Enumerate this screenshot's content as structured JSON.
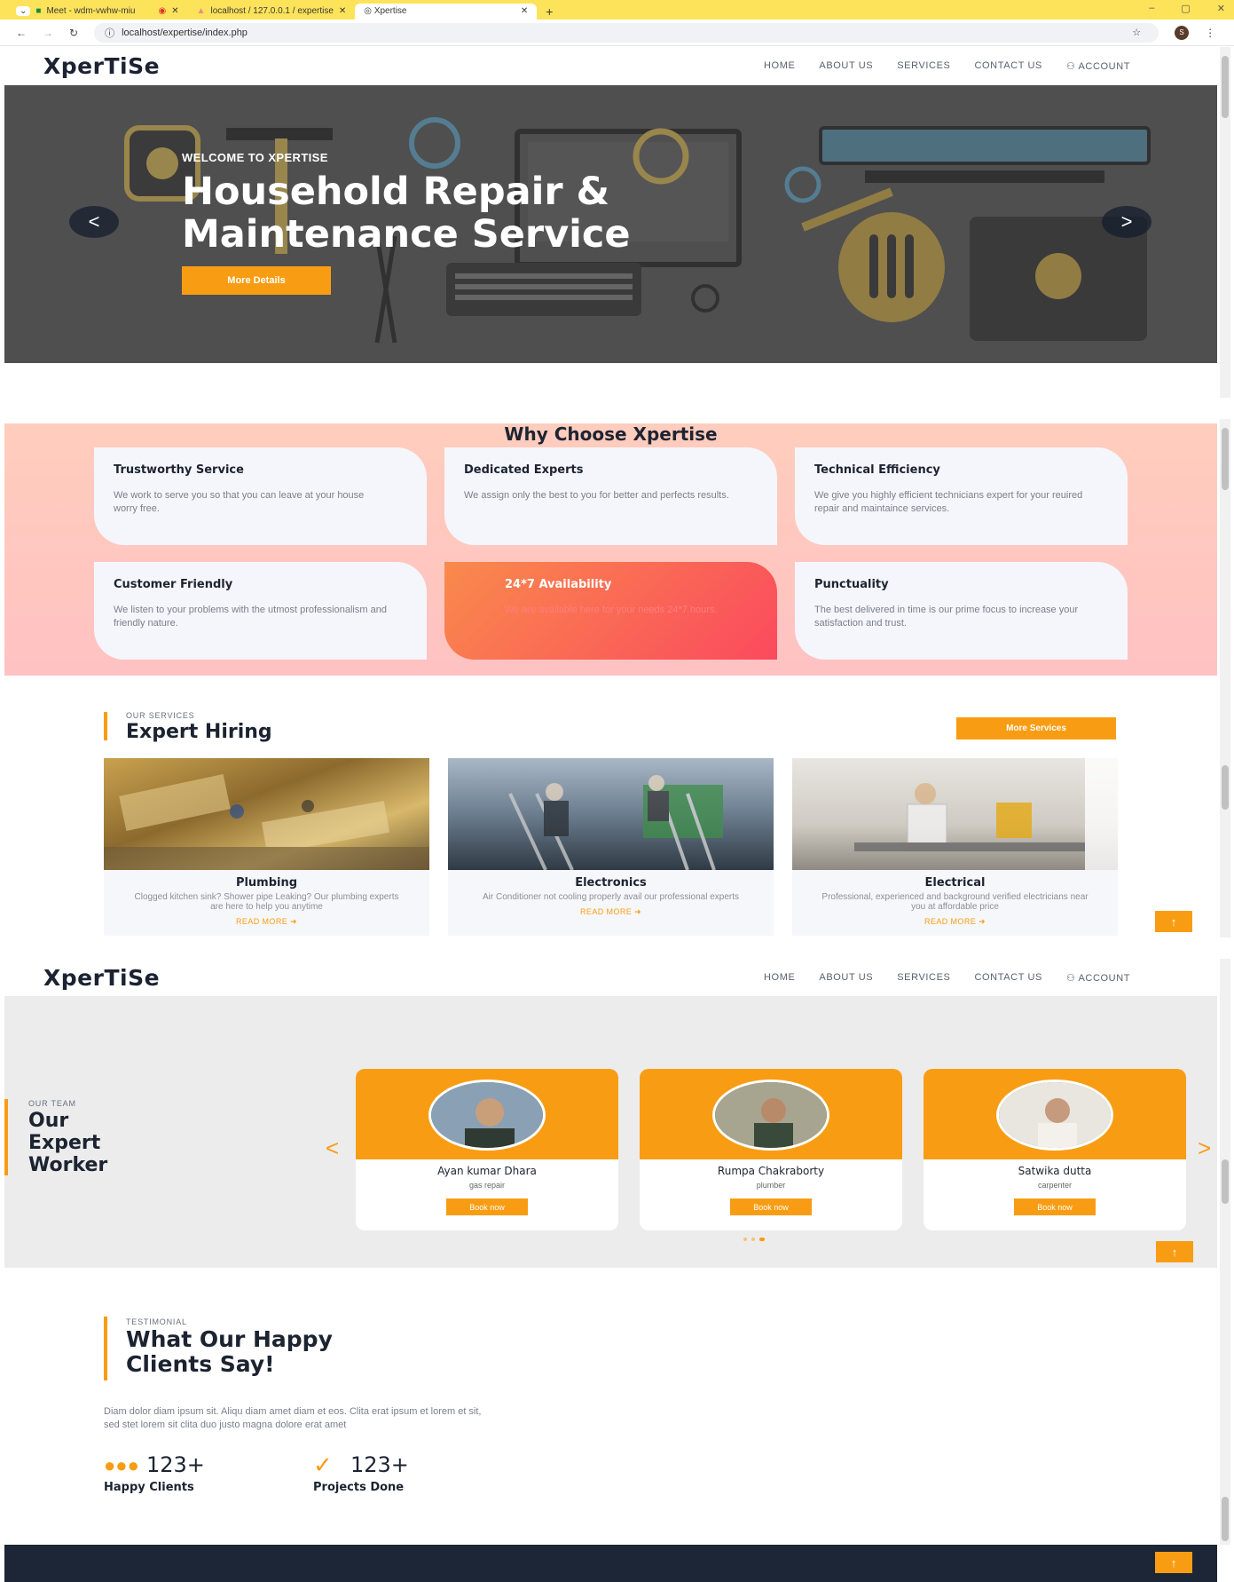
{
  "browser": {
    "tabs": [
      {
        "label": "Meet - wdm-vwhw-miu"
      },
      {
        "label": "localhost / 127.0.0.1 / expertise"
      },
      {
        "label": "Xpertise"
      }
    ],
    "new_tab": "+",
    "url": "localhost/expertise/index.php",
    "profile_initial": "S",
    "window_controls": [
      "–",
      "▢",
      "✕"
    ]
  },
  "nav": {
    "brand": "XperTiSe",
    "items": [
      "HOME",
      "ABOUT US",
      "SERVICES",
      "CONTACT US",
      "ACCOUNT"
    ]
  },
  "hero": {
    "eyebrow": "WELCOME TO XPERTISE",
    "title": "Household Repair & Maintenance Service",
    "cta": "More Details",
    "prev": "<",
    "next": ">"
  },
  "why": {
    "title": "Why Choose Xpertise",
    "cards": [
      {
        "title": "Trustworthy Service",
        "text": "We work to serve you so that you can leave at your house worry free."
      },
      {
        "title": "Dedicated Experts",
        "text": "We assign only the best to you for better and perfects results."
      },
      {
        "title": "Technical Efficiency",
        "text": "We give you highly efficient technicians expert for your reuired repair and maintaince services."
      },
      {
        "title": "Customer Friendly",
        "text": "We listen to your problems with the utmost professionalism and friendly nature."
      },
      {
        "title": "24*7 Availability",
        "text": "We are available here for your needs 24*7 hours."
      },
      {
        "title": "Punctuality",
        "text": "The best delivered in time is our prime focus to increase your satisfaction and trust."
      }
    ]
  },
  "services": {
    "eyebrow": "OUR SERVICES",
    "title": "Expert Hiring",
    "more_button": "More Services",
    "items": [
      {
        "title": "Plumbing",
        "text": "Clogged kitchen sink? Shower pipe Leaking? Our plumbing experts are here to help you anytime",
        "link": "READ MORE"
      },
      {
        "title": "Electronics",
        "text": "Air Conditioner not cooling properly avail our professional experts",
        "link": "READ MORE"
      },
      {
        "title": "Electrical",
        "text": "Professional, experienced and background verified electricians near you at affordable price",
        "link": "READ MORE"
      }
    ],
    "to_top": "↑"
  },
  "team": {
    "eyebrow": "OUR TEAM",
    "title_lines": [
      "Our",
      "Expert",
      "Worker"
    ],
    "prev": "<",
    "next": ">",
    "members": [
      {
        "name": "Ayan kumar Dhara",
        "role": "gas repair",
        "button": "Book now"
      },
      {
        "name": "Rumpa Chakraborty",
        "role": "plumber",
        "button": "Book now"
      },
      {
        "name": "Satwika dutta",
        "role": "carpenter",
        "button": "Book now"
      }
    ],
    "to_top": "↑"
  },
  "testimonial": {
    "eyebrow": "TESTIMONIAL",
    "title_lines": [
      "What Our Happy",
      "Clients Say!"
    ],
    "body": "Diam dolor diam ipsum sit. Aliqu diam amet diam et eos. Clita erat ipsum et lorem et sit, sed stet lorem sit clita duo justo magna dolore erat amet",
    "stats": [
      {
        "value": "123+",
        "label": "Happy Clients",
        "icon": "users-icon"
      },
      {
        "value": "123+",
        "label": "Projects Done",
        "icon": "check-icon"
      }
    ],
    "to_top": "↑"
  },
  "colors": {
    "accent": "#f89d13",
    "dark": "#1c2331",
    "highlight_card": "#fb4a5e"
  }
}
